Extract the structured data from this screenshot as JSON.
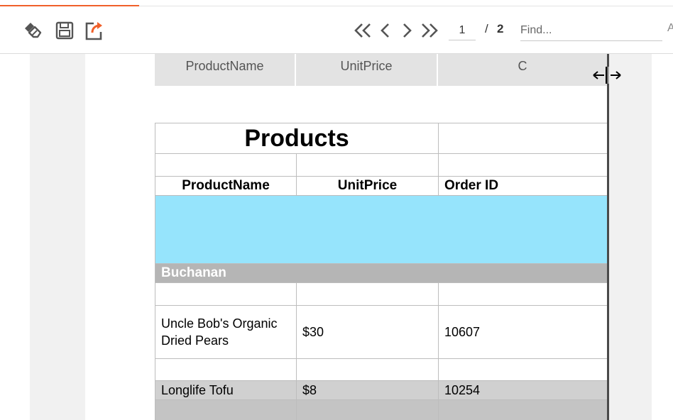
{
  "toolbar": {
    "icons": [
      "paintbrush-icon",
      "save-icon",
      "export-icon"
    ],
    "nav_icons": [
      "first-page-icon",
      "previous-page-icon",
      "next-page-icon",
      "last-page-icon"
    ],
    "page_current": "1",
    "page_separator": "/",
    "page_total": "2",
    "find_placeholder": "Find...",
    "overflow_glyph": "A",
    "accent_color": "#f0602a"
  },
  "header_band": {
    "columns": [
      "ProductName",
      "UnitPrice",
      "C"
    ]
  },
  "report": {
    "title": "Products",
    "column_headers": [
      "ProductName",
      "UnitPrice",
      "Order ID"
    ],
    "band_color": "#96e4fc",
    "group_label": "Buchanan",
    "rows": [
      {
        "product": "Uncle Bob's Organic Dried Pears",
        "price": "$30",
        "order_id": "10607"
      },
      {
        "product": "Longlife Tofu",
        "price": "$8",
        "order_id": "10254"
      }
    ]
  },
  "cursor": "col-resize-cursor-icon"
}
